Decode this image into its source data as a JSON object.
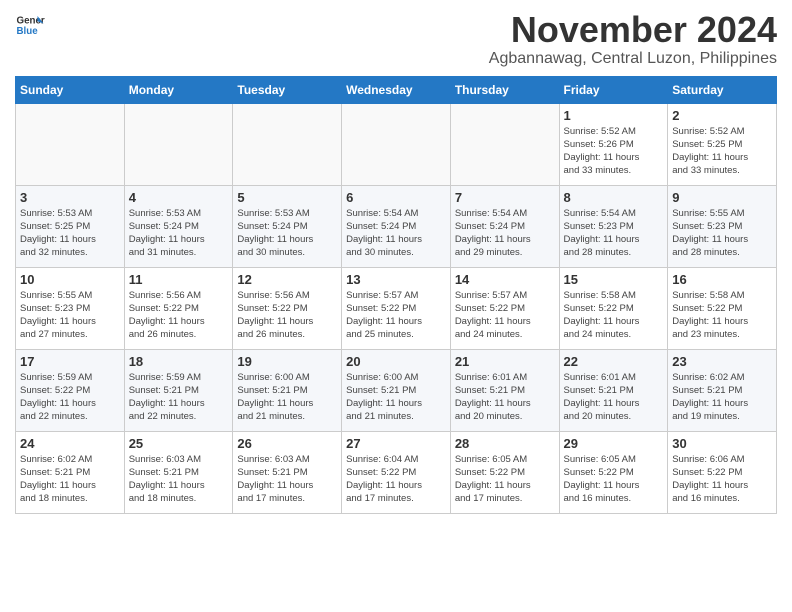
{
  "header": {
    "logo_general": "General",
    "logo_blue": "Blue",
    "month_title": "November 2024",
    "location": "Agbannawag, Central Luzon, Philippines"
  },
  "days_of_week": [
    "Sunday",
    "Monday",
    "Tuesday",
    "Wednesday",
    "Thursday",
    "Friday",
    "Saturday"
  ],
  "weeks": [
    [
      {
        "day": "",
        "info": ""
      },
      {
        "day": "",
        "info": ""
      },
      {
        "day": "",
        "info": ""
      },
      {
        "day": "",
        "info": ""
      },
      {
        "day": "",
        "info": ""
      },
      {
        "day": "1",
        "info": "Sunrise: 5:52 AM\nSunset: 5:26 PM\nDaylight: 11 hours\nand 33 minutes."
      },
      {
        "day": "2",
        "info": "Sunrise: 5:52 AM\nSunset: 5:25 PM\nDaylight: 11 hours\nand 33 minutes."
      }
    ],
    [
      {
        "day": "3",
        "info": "Sunrise: 5:53 AM\nSunset: 5:25 PM\nDaylight: 11 hours\nand 32 minutes."
      },
      {
        "day": "4",
        "info": "Sunrise: 5:53 AM\nSunset: 5:24 PM\nDaylight: 11 hours\nand 31 minutes."
      },
      {
        "day": "5",
        "info": "Sunrise: 5:53 AM\nSunset: 5:24 PM\nDaylight: 11 hours\nand 30 minutes."
      },
      {
        "day": "6",
        "info": "Sunrise: 5:54 AM\nSunset: 5:24 PM\nDaylight: 11 hours\nand 30 minutes."
      },
      {
        "day": "7",
        "info": "Sunrise: 5:54 AM\nSunset: 5:24 PM\nDaylight: 11 hours\nand 29 minutes."
      },
      {
        "day": "8",
        "info": "Sunrise: 5:54 AM\nSunset: 5:23 PM\nDaylight: 11 hours\nand 28 minutes."
      },
      {
        "day": "9",
        "info": "Sunrise: 5:55 AM\nSunset: 5:23 PM\nDaylight: 11 hours\nand 28 minutes."
      }
    ],
    [
      {
        "day": "10",
        "info": "Sunrise: 5:55 AM\nSunset: 5:23 PM\nDaylight: 11 hours\nand 27 minutes."
      },
      {
        "day": "11",
        "info": "Sunrise: 5:56 AM\nSunset: 5:22 PM\nDaylight: 11 hours\nand 26 minutes."
      },
      {
        "day": "12",
        "info": "Sunrise: 5:56 AM\nSunset: 5:22 PM\nDaylight: 11 hours\nand 26 minutes."
      },
      {
        "day": "13",
        "info": "Sunrise: 5:57 AM\nSunset: 5:22 PM\nDaylight: 11 hours\nand 25 minutes."
      },
      {
        "day": "14",
        "info": "Sunrise: 5:57 AM\nSunset: 5:22 PM\nDaylight: 11 hours\nand 24 minutes."
      },
      {
        "day": "15",
        "info": "Sunrise: 5:58 AM\nSunset: 5:22 PM\nDaylight: 11 hours\nand 24 minutes."
      },
      {
        "day": "16",
        "info": "Sunrise: 5:58 AM\nSunset: 5:22 PM\nDaylight: 11 hours\nand 23 minutes."
      }
    ],
    [
      {
        "day": "17",
        "info": "Sunrise: 5:59 AM\nSunset: 5:22 PM\nDaylight: 11 hours\nand 22 minutes."
      },
      {
        "day": "18",
        "info": "Sunrise: 5:59 AM\nSunset: 5:21 PM\nDaylight: 11 hours\nand 22 minutes."
      },
      {
        "day": "19",
        "info": "Sunrise: 6:00 AM\nSunset: 5:21 PM\nDaylight: 11 hours\nand 21 minutes."
      },
      {
        "day": "20",
        "info": "Sunrise: 6:00 AM\nSunset: 5:21 PM\nDaylight: 11 hours\nand 21 minutes."
      },
      {
        "day": "21",
        "info": "Sunrise: 6:01 AM\nSunset: 5:21 PM\nDaylight: 11 hours\nand 20 minutes."
      },
      {
        "day": "22",
        "info": "Sunrise: 6:01 AM\nSunset: 5:21 PM\nDaylight: 11 hours\nand 20 minutes."
      },
      {
        "day": "23",
        "info": "Sunrise: 6:02 AM\nSunset: 5:21 PM\nDaylight: 11 hours\nand 19 minutes."
      }
    ],
    [
      {
        "day": "24",
        "info": "Sunrise: 6:02 AM\nSunset: 5:21 PM\nDaylight: 11 hours\nand 18 minutes."
      },
      {
        "day": "25",
        "info": "Sunrise: 6:03 AM\nSunset: 5:21 PM\nDaylight: 11 hours\nand 18 minutes."
      },
      {
        "day": "26",
        "info": "Sunrise: 6:03 AM\nSunset: 5:21 PM\nDaylight: 11 hours\nand 17 minutes."
      },
      {
        "day": "27",
        "info": "Sunrise: 6:04 AM\nSunset: 5:22 PM\nDaylight: 11 hours\nand 17 minutes."
      },
      {
        "day": "28",
        "info": "Sunrise: 6:05 AM\nSunset: 5:22 PM\nDaylight: 11 hours\nand 17 minutes."
      },
      {
        "day": "29",
        "info": "Sunrise: 6:05 AM\nSunset: 5:22 PM\nDaylight: 11 hours\nand 16 minutes."
      },
      {
        "day": "30",
        "info": "Sunrise: 6:06 AM\nSunset: 5:22 PM\nDaylight: 11 hours\nand 16 minutes."
      }
    ]
  ]
}
